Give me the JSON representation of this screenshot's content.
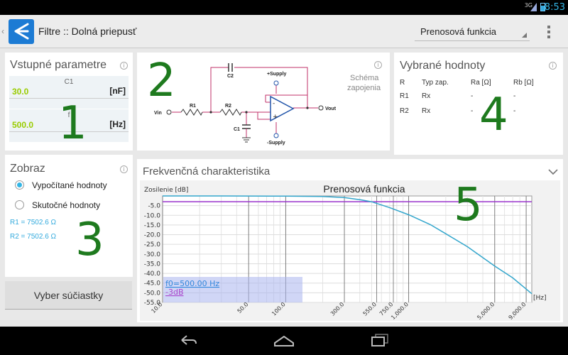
{
  "status_bar": {
    "network": "3G",
    "time": "8:53"
  },
  "action_bar": {
    "title": "Filtre :: Dolná priepusť",
    "spinner_value": "Prenosová funkcia"
  },
  "input_params": {
    "title": "Vstupné parametre",
    "fields": [
      {
        "label": "C1",
        "value": "30.0",
        "unit": "[nF]"
      },
      {
        "label": "f",
        "value": "500.0",
        "unit": "[Hz]"
      }
    ],
    "marker": "1"
  },
  "schematic": {
    "caption_line1": "Schéma",
    "caption_line2": "zapojenia",
    "labels": {
      "vin": "Vin",
      "vout": "Vout",
      "r1": "R1",
      "r2": "R2",
      "c1": "C1",
      "c2": "C2",
      "plus": "+Supply",
      "minus": "-Supply",
      "op_minus": "-",
      "op_plus": "+"
    },
    "marker": "2"
  },
  "display": {
    "title": "Zobraz",
    "options": [
      {
        "label": "Vypočítané hodnoty",
        "selected": true
      },
      {
        "label": "Skutočné hodnoty",
        "selected": false
      }
    ],
    "results": [
      "R1 = 7502.6 Ω",
      "R2 = 7502.6 Ω"
    ],
    "marker": "3"
  },
  "select_button": {
    "label": "Vyber súčiastky"
  },
  "selected_values": {
    "title": "Vybrané hodnoty",
    "headers": [
      "R",
      "Typ zap.",
      "Ra [Ω]",
      "Rb [Ω]"
    ],
    "rows": [
      [
        "R1",
        "Rx",
        "-",
        "-"
      ],
      [
        "R2",
        "Rx",
        "-",
        "-"
      ]
    ],
    "marker": "4"
  },
  "frequency": {
    "title": "Frekvenčná charakteristika",
    "marker": "5"
  },
  "chart_data": {
    "type": "line",
    "title": "Prenosová funkcia",
    "ylabel": "Zosilenie [dB]",
    "xlabel": "[Hz]",
    "xscale": "log",
    "xlim": [
      10,
      10000
    ],
    "ylim": [
      -55,
      0
    ],
    "xticks": [
      10,
      50,
      100,
      300,
      550,
      750,
      1000,
      5000,
      9000
    ],
    "xtick_labels": [
      "10.0",
      "50.0",
      "100.0",
      "300.0",
      "550.0",
      "750.0",
      "1,000.0",
      "5,000.0",
      "9,000.0"
    ],
    "yticks": [
      -5,
      -10,
      -15,
      -20,
      -25,
      -30,
      -35,
      -40,
      -45,
      -50,
      -55
    ],
    "ytick_labels": [
      "-5.0",
      "-10.0",
      "-15.0",
      "-20.0",
      "-25.0",
      "-30.0",
      "-35.0",
      "-40.0",
      "-45.0",
      "-50.0",
      "-55.0"
    ],
    "series": [
      {
        "color": "#33a6cc",
        "x": [
          10,
          30,
          100,
          200,
          300,
          400,
          500,
          700,
          1000,
          1500,
          2000,
          3000,
          5000,
          7000,
          10000
        ],
        "y": [
          0,
          0,
          -0.1,
          -0.3,
          -0.8,
          -1.9,
          -3,
          -6,
          -9.7,
          -14.8,
          -19.5,
          -26.2,
          -36.2,
          -42.3,
          -50.5
        ]
      }
    ],
    "reference_line": {
      "y": -3,
      "color": "#9933cc"
    },
    "grid": true,
    "legend": [
      {
        "text": "f0=500.00 Hz",
        "color": "#3388dd"
      },
      {
        "text": "-3dB",
        "color": "#aa44cc"
      }
    ],
    "legend_position": "bottom-left"
  }
}
